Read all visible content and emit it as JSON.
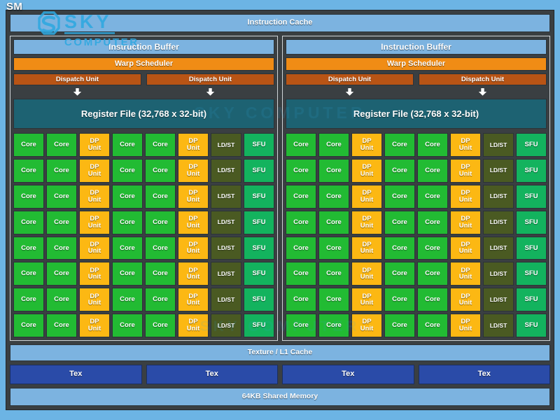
{
  "diagram": {
    "title": "SM",
    "instruction_cache": "Instruction Cache",
    "texture_l1_cache": "Texture / L1 Cache",
    "shared_memory": "64KB Shared Memory",
    "tex_units": [
      "Tex",
      "Tex",
      "Tex",
      "Tex"
    ],
    "partitions": [
      {
        "instruction_buffer": "Instruction Buffer",
        "warp_scheduler": "Warp Scheduler",
        "dispatch_units": [
          "Dispatch Unit",
          "Dispatch Unit"
        ],
        "register_file": "Register File (32,768 x 32-bit)"
      },
      {
        "instruction_buffer": "Instruction Buffer",
        "warp_scheduler": "Warp Scheduler",
        "dispatch_units": [
          "Dispatch Unit",
          "Dispatch Unit"
        ],
        "register_file": "Register File (32,768 x 32-bit)"
      }
    ],
    "core_grid": {
      "rows": 8,
      "columns": 8,
      "column_types": [
        "core",
        "core",
        "dp",
        "core",
        "core",
        "dp",
        "ldst",
        "sfu"
      ],
      "labels": {
        "core": "Core",
        "dp": "DP\nUnit",
        "ldst": "LD/ST",
        "sfu": "SFU"
      }
    },
    "watermark": {
      "brand": "SKY",
      "subtitle": "COMPUTER",
      "center_text": "SKY COMPUTER",
      "lower_text": "SKY COMPUTER"
    },
    "colors": {
      "page_background": "#6cb4e4",
      "frame": "#3a3f42",
      "instruction_cache": "#7cb3e0",
      "instruction_buffer": "#7cb3e0",
      "warp_scheduler": "#f08c15",
      "dispatch_unit": "#b85415",
      "register_file": "#1d6272",
      "core": "#22bb33",
      "dp_unit": "#fcb813",
      "ld_st": "#4a5a22",
      "sfu": "#13b35e",
      "tex_unit": "#2a4ba8",
      "shared_memory": "#7cb3e0",
      "watermark": "#2ea8e0"
    }
  }
}
